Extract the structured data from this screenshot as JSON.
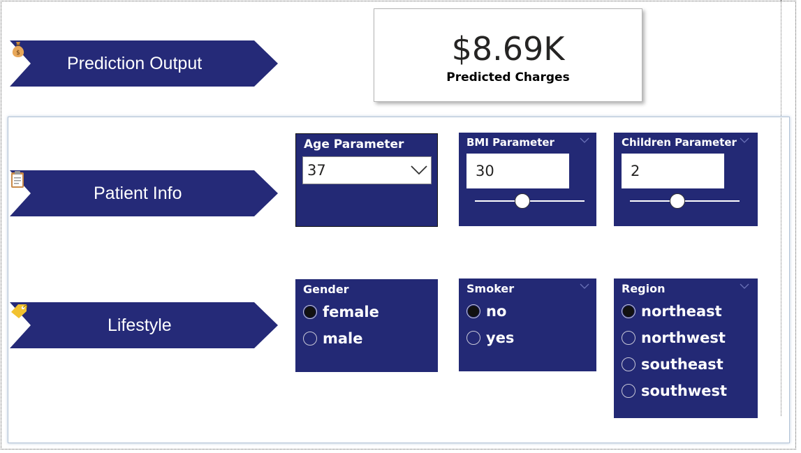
{
  "banners": {
    "prediction": {
      "label": "Prediction Output",
      "icon": "money-bag-icon"
    },
    "patient": {
      "label": "Patient Info",
      "icon": "clipboard-icon"
    },
    "lifestyle": {
      "label": "Lifestyle",
      "icon": "label-tag-icon"
    }
  },
  "kpi": {
    "value": "$8.69K",
    "label": "Predicted Charges"
  },
  "slicers": {
    "age": {
      "title": "Age Parameter",
      "value": "37"
    },
    "bmi": {
      "title": "BMI Parameter",
      "value": "30",
      "slider_fraction": 0.43
    },
    "children": {
      "title": "Children Parameter",
      "value": "2",
      "slider_fraction": 0.43
    },
    "gender": {
      "title": "Gender",
      "options": [
        {
          "label": "female",
          "selected": true
        },
        {
          "label": "male",
          "selected": false
        }
      ]
    },
    "smoker": {
      "title": "Smoker",
      "options": [
        {
          "label": "no",
          "selected": true
        },
        {
          "label": "yes",
          "selected": false
        }
      ]
    },
    "region": {
      "title": "Region",
      "options": [
        {
          "label": "northeast",
          "selected": true
        },
        {
          "label": "northwest",
          "selected": false
        },
        {
          "label": "southeast",
          "selected": false
        },
        {
          "label": "southwest",
          "selected": false
        }
      ]
    }
  },
  "colors": {
    "navy": "#252a78",
    "slicer_bg": "#232975",
    "white": "#ffffff"
  }
}
